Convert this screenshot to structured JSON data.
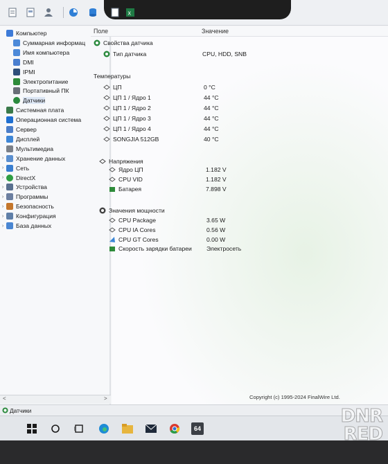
{
  "tree": {
    "items": [
      {
        "label": "Компьютер",
        "depth": 0,
        "twisty": "",
        "icon": "computer-icon",
        "color": "#3d7bd8",
        "selected": false
      },
      {
        "label": "Суммарная информац",
        "depth": 1,
        "twisty": "",
        "icon": "summary-icon",
        "color": "#4d8ad9",
        "selected": false
      },
      {
        "label": "Имя компьютера",
        "depth": 1,
        "twisty": "",
        "icon": "computer-name-icon",
        "color": "#4d8ad9",
        "selected": false
      },
      {
        "label": "DMI",
        "depth": 1,
        "twisty": "",
        "icon": "dmi-icon",
        "color": "#4a7fd0",
        "selected": false
      },
      {
        "label": "IPMI",
        "depth": 1,
        "twisty": "",
        "icon": "ipmi-icon",
        "color": "#2f4f7a",
        "selected": false
      },
      {
        "label": "Электропитание",
        "depth": 1,
        "twisty": "",
        "icon": "power-icon",
        "color": "#2e8b3a",
        "selected": false
      },
      {
        "label": "Портативный ПК",
        "depth": 1,
        "twisty": "",
        "icon": "laptop-icon",
        "color": "#6a6f78",
        "selected": false
      },
      {
        "label": "Датчики",
        "depth": 1,
        "twisty": "",
        "icon": "sensor-icon",
        "color": "#2b8a3e",
        "selected": true
      },
      {
        "label": "Системная плата",
        "depth": 0,
        "twisty": "",
        "icon": "motherboard-icon",
        "color": "#3a7a4a",
        "selected": false
      },
      {
        "label": "Операционная система",
        "depth": 0,
        "twisty": "",
        "icon": "windows-icon",
        "color": "#1f6fd1",
        "selected": false
      },
      {
        "label": "Сервер",
        "depth": 0,
        "twisty": "",
        "icon": "server-icon",
        "color": "#4b7ec9",
        "selected": false
      },
      {
        "label": "Дисплей",
        "depth": 0,
        "twisty": "",
        "icon": "display-icon",
        "color": "#3e86d6",
        "selected": false
      },
      {
        "label": "Мультимедиа",
        "depth": 0,
        "twisty": "",
        "icon": "multimedia-icon",
        "color": "#7b8088",
        "selected": false
      },
      {
        "label": "Хранение данных",
        "depth": 0,
        "twisty": "›",
        "icon": "storage-icon",
        "color": "#5a8fcf",
        "selected": false
      },
      {
        "label": "Сеть",
        "depth": 0,
        "twisty": "›",
        "icon": "network-icon",
        "color": "#3a7fd0",
        "selected": false
      },
      {
        "label": "DirectX",
        "depth": 0,
        "twisty": "›",
        "icon": "directx-icon",
        "color": "#2f9e44",
        "selected": false
      },
      {
        "label": "Устройства",
        "depth": 0,
        "twisty": "›",
        "icon": "devices-icon",
        "color": "#59708f",
        "selected": false
      },
      {
        "label": "Программы",
        "depth": 0,
        "twisty": "›",
        "icon": "programs-icon",
        "color": "#6c7fa0",
        "selected": false
      },
      {
        "label": "Безопасность",
        "depth": 0,
        "twisty": "›",
        "icon": "security-icon",
        "color": "#c4762b",
        "selected": false
      },
      {
        "label": "Конфигурация",
        "depth": 0,
        "twisty": "›",
        "icon": "configuration-icon",
        "color": "#5f7fa8",
        "selected": false
      },
      {
        "label": "База данных",
        "depth": 0,
        "twisty": "›",
        "icon": "database-icon",
        "color": "#4a86d2",
        "selected": false
      }
    ],
    "scroll_left": "<",
    "scroll_right": ">"
  },
  "columns": {
    "field": "Поле",
    "value": "Значение"
  },
  "rows": [
    {
      "type": "section",
      "label": "Свойства датчика",
      "icon": "sensor-props-icon",
      "color": "#2b8a3e",
      "value": ""
    },
    {
      "type": "item",
      "label": "Тип датчика",
      "icon": "sensor-type-icon",
      "color": "#2b8a3e",
      "value": "CPU, HDD, SNB"
    },
    {
      "type": "section",
      "label": "Температуры",
      "icon": "",
      "color": "",
      "value": ""
    },
    {
      "type": "item",
      "label": "ЦП",
      "icon": "temperature-icon",
      "color": "#555",
      "value": "0 °C"
    },
    {
      "type": "item",
      "label": "ЦП 1 / Ядро 1",
      "icon": "temperature-icon",
      "color": "#555",
      "value": "44 °C"
    },
    {
      "type": "item",
      "label": "ЦП 1 / Ядро 2",
      "icon": "temperature-icon",
      "color": "#555",
      "value": "44 °C"
    },
    {
      "type": "item",
      "label": "ЦП 1 / Ядро 3",
      "icon": "temperature-icon",
      "color": "#555",
      "value": "44 °C"
    },
    {
      "type": "item",
      "label": "ЦП 1 / Ядро 4",
      "icon": "temperature-icon",
      "color": "#555",
      "value": "44 °C"
    },
    {
      "type": "item",
      "label": "SONGJIA 512GB",
      "icon": "disk-icon",
      "color": "#555",
      "value": "40 °C"
    },
    {
      "type": "section",
      "label": "Напряжения",
      "icon": "voltage-icon",
      "color": "#444",
      "value": ""
    },
    {
      "type": "item",
      "label": "Ядро ЦП",
      "icon": "voltage-icon",
      "color": "#555",
      "value": "1.182 V"
    },
    {
      "type": "item",
      "label": "CPU VID",
      "icon": "voltage-icon",
      "color": "#555",
      "value": "1.182 V"
    },
    {
      "type": "item",
      "label": "Батарея",
      "icon": "battery-icon",
      "color": "#2e8b3a",
      "value": "7.898 V"
    },
    {
      "type": "section",
      "label": "Значения мощности",
      "icon": "power-values-icon",
      "color": "#444",
      "value": ""
    },
    {
      "type": "item",
      "label": "CPU Package",
      "icon": "power-icon",
      "color": "#555",
      "value": "3.65 W"
    },
    {
      "type": "item",
      "label": "CPU IA Cores",
      "icon": "power-icon",
      "color": "#555",
      "value": "0.56 W"
    },
    {
      "type": "item",
      "label": "CPU GT Cores",
      "icon": "gpu-icon",
      "color": "#3a86d6",
      "value": "0.00 W"
    },
    {
      "type": "item",
      "label": "Скорость зарядки батареи",
      "icon": "battery-icon",
      "color": "#2e8b3a",
      "value": "Электросеть"
    }
  ],
  "copyright": "Copyright (c) 1995-2024 FinalWire Ltd.",
  "status_label": "Датчики",
  "taskbar": {
    "badge": "64"
  },
  "watermark": {
    "line1": "DNR",
    "line2": "RED"
  }
}
